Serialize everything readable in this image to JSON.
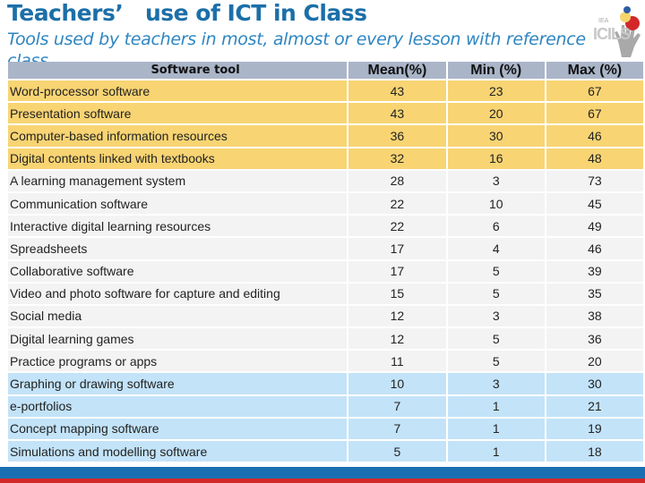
{
  "title": "Teachers’   use of ICT in Class",
  "subtitle": "Tools used by teachers in most, almost or every lesson with reference class",
  "logo": {
    "org": "IEA",
    "name": "ICILS",
    "icon": "hand-logo-icon"
  },
  "table": {
    "headers": {
      "tool": "Software tool",
      "mean": "Mean(%)",
      "min": "Min (%)",
      "max": "Max (%)"
    },
    "group_colors": {
      "high": "#f8d473",
      "mid": "#f3f3f3",
      "low": "#c3e3f8"
    },
    "rows": [
      {
        "tool": "Word-processor software",
        "mean": "43",
        "min": "23",
        "max": "67",
        "group": "high"
      },
      {
        "tool": "Presentation software",
        "mean": "43",
        "min": "20",
        "max": "67",
        "group": "high"
      },
      {
        "tool": "Computer-based information resources",
        "mean": "36",
        "min": "30",
        "max": "46",
        "group": "high"
      },
      {
        "tool": "Digital contents linked with textbooks",
        "mean": "32",
        "min": "16",
        "max": "48",
        "group": "high"
      },
      {
        "tool": "A learning management system",
        "mean": "28",
        "min": "3",
        "max": "73",
        "group": "mid"
      },
      {
        "tool": "Communication software",
        "mean": "22",
        "min": "10",
        "max": "45",
        "group": "mid"
      },
      {
        "tool": "Interactive digital learning resources",
        "mean": "22",
        "min": "6",
        "max": "49",
        "group": "mid"
      },
      {
        "tool": "Spreadsheets",
        "mean": "17",
        "min": "4",
        "max": "46",
        "group": "mid"
      },
      {
        "tool": "Collaborative software",
        "mean": "17",
        "min": "5",
        "max": "39",
        "group": "mid"
      },
      {
        "tool": "Video and photo software for capture and editing",
        "mean": "15",
        "min": "5",
        "max": "35",
        "group": "mid"
      },
      {
        "tool": "Social media",
        "mean": "12",
        "min": "3",
        "max": "38",
        "group": "mid"
      },
      {
        "tool": "Digital learning games",
        "mean": "12",
        "min": "5",
        "max": "36",
        "group": "mid"
      },
      {
        "tool": "Practice programs or apps",
        "mean": "11",
        "min": "5",
        "max": "20",
        "group": "mid"
      },
      {
        "tool": "Graphing or drawing software",
        "mean": "10",
        "min": "3",
        "max": "30",
        "group": "low"
      },
      {
        "tool": "e-portfolios",
        "mean": "7",
        "min": "1",
        "max": "21",
        "group": "low"
      },
      {
        "tool": "Concept mapping software",
        "mean": "7",
        "min": "1",
        "max": "19",
        "group": "low"
      },
      {
        "tool": "Simulations and modelling software",
        "mean": "5",
        "min": "1",
        "max": "18",
        "group": "low"
      }
    ]
  },
  "chart_data": {
    "type": "table",
    "title": "Teachers’ use of ICT in Class",
    "subtitle": "Tools used by teachers in most, almost or every lesson with reference class",
    "columns": [
      "Software tool",
      "Mean(%)",
      "Min (%)",
      "Max (%)"
    ],
    "rows": [
      [
        "Word-processor software",
        43,
        23,
        67
      ],
      [
        "Presentation software",
        43,
        20,
        67
      ],
      [
        "Computer-based information resources",
        36,
        30,
        46
      ],
      [
        "Digital contents linked with textbooks",
        32,
        16,
        48
      ],
      [
        "A learning management system",
        28,
        3,
        73
      ],
      [
        "Communication software",
        22,
        10,
        45
      ],
      [
        "Interactive digital learning resources",
        22,
        6,
        49
      ],
      [
        "Spreadsheets",
        17,
        4,
        46
      ],
      [
        "Collaborative software",
        17,
        5,
        39
      ],
      [
        "Video and photo software for capture and editing",
        15,
        5,
        35
      ],
      [
        "Social media",
        12,
        3,
        38
      ],
      [
        "Digital learning games",
        12,
        5,
        36
      ],
      [
        "Practice programs or apps",
        11,
        5,
        20
      ],
      [
        "Graphing or drawing software",
        10,
        3,
        30
      ],
      [
        "e-portfolios",
        7,
        1,
        21
      ],
      [
        "Concept mapping software",
        7,
        1,
        19
      ],
      [
        "Simulations and modelling software",
        5,
        1,
        18
      ]
    ]
  }
}
